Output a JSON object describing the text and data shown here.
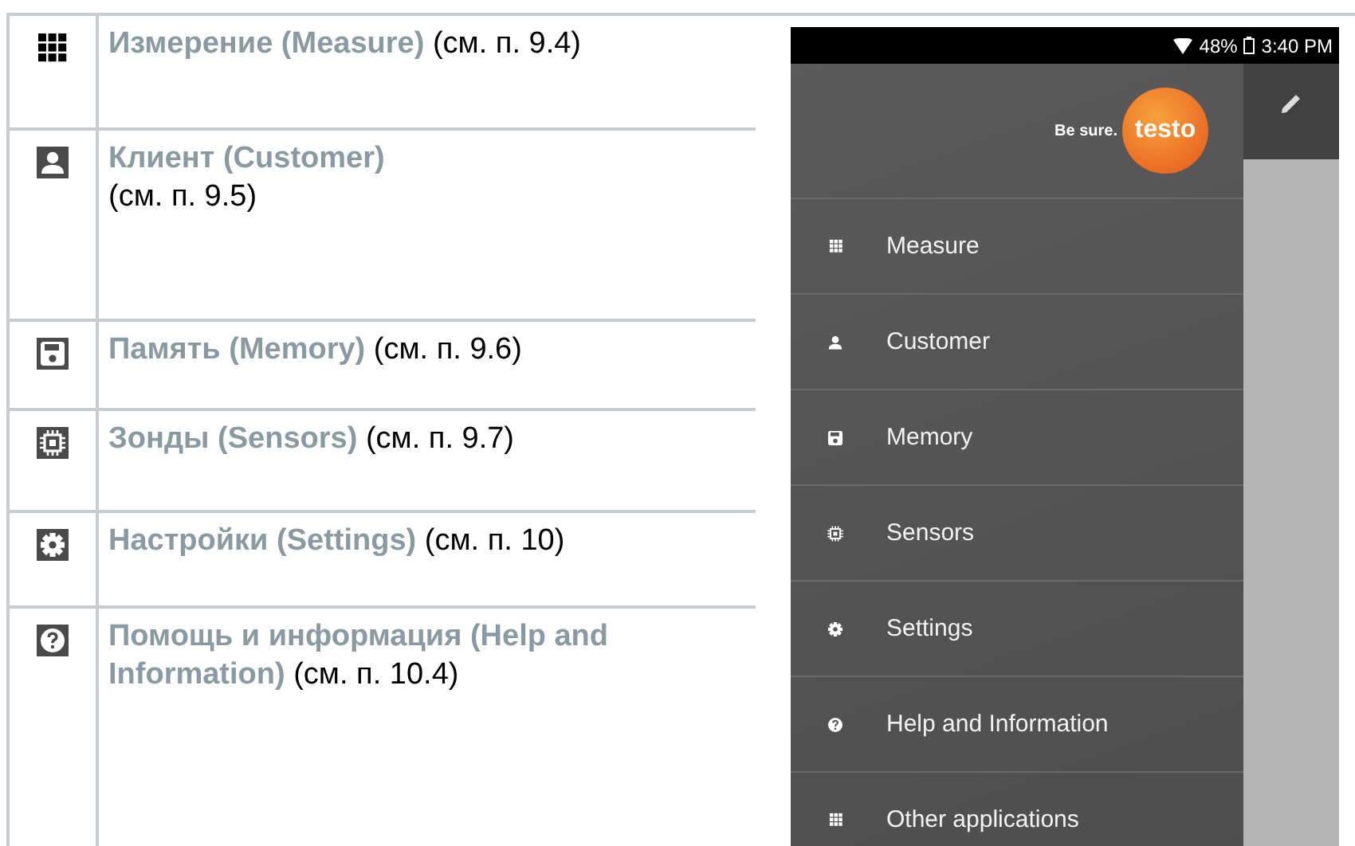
{
  "table": {
    "rows": [
      {
        "kind": "grid",
        "text": "**Измерение (Measure)** (см. п. 9.4)"
      },
      {
        "kind": "person",
        "text": "**Клиент (Customer)**\n(см. п. 9.5)"
      },
      {
        "kind": "save",
        "text": "**Память (Memory)** (см. п. 9.6)"
      },
      {
        "kind": "chip",
        "text": "**Зонды (Sensors)** (см. п. 9.7)"
      },
      {
        "kind": "gear",
        "text": "**Настройки (Settings)** (см. п. 10)"
      },
      {
        "kind": "help",
        "text": "**Помощь и информация (Help and Information)** (см. п. 10.4)"
      }
    ]
  },
  "phone": {
    "status_bar": {
      "battery": "48%",
      "time": "3:40 PM"
    },
    "drawer": {
      "slogan": "Be sure.",
      "logo": "testo",
      "items": [
        {
          "kind": "grid",
          "label": "Measure"
        },
        {
          "kind": "person",
          "label": "Customer"
        },
        {
          "kind": "save",
          "label": "Memory"
        },
        {
          "kind": "chip",
          "label": "Sensors"
        },
        {
          "kind": "gear",
          "label": "Settings"
        },
        {
          "kind": "help",
          "label": "Help and Information"
        },
        {
          "kind": "grid",
          "label": "Other applications"
        }
      ]
    }
  }
}
